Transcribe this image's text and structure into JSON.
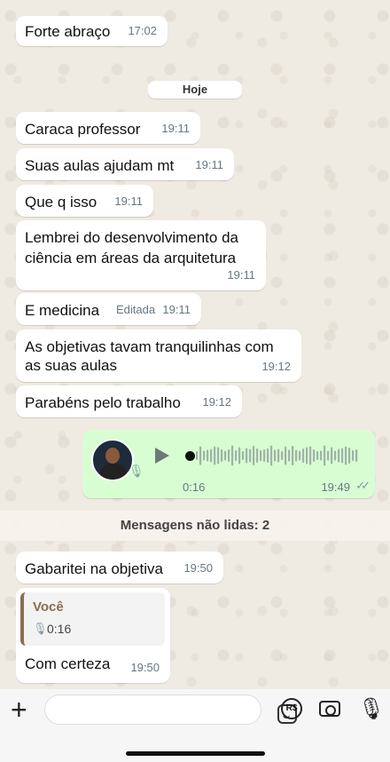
{
  "messages": [
    {
      "text": "Forte abraço",
      "time": "17:02"
    },
    {
      "text": "Caraca professor",
      "time": "19:11"
    },
    {
      "text": "Suas aulas ajudam mt",
      "time": "19:11"
    },
    {
      "text": "Que q isso",
      "time": "19:11"
    },
    {
      "line1": "Lembrei do desenvolvimento da",
      "line2": "ciência em áreas da arquitetura",
      "time": "19:11"
    },
    {
      "text": "E medicina",
      "edited": "Editada",
      "time": "19:11"
    },
    {
      "line1": "As objetivas tavam tranquilinhas com",
      "line2": "as suas aulas",
      "time": "19:12"
    },
    {
      "text": "Parabéns pelo trabalho",
      "time": "19:12"
    },
    {
      "text": "Gabaritei na objetiva",
      "time": "19:50"
    },
    {
      "text": "Com certeza",
      "time": "19:50"
    }
  ],
  "day_separator": "Hoje",
  "voice_message": {
    "duration": "0:16",
    "time": "19:49",
    "status_icon": "double-check-icon"
  },
  "unread_banner": "Mensagens não lidas: 2",
  "reply_quote": {
    "author": "Você",
    "duration": "0:16"
  },
  "bottom_bar": {
    "rs_label": "R$"
  },
  "colors": {
    "outgoing_bubble": "#d9fdd3",
    "incoming_bubble": "#ffffff",
    "chat_bg": "#efeae2",
    "quote_accent": "#8b6d4f"
  }
}
